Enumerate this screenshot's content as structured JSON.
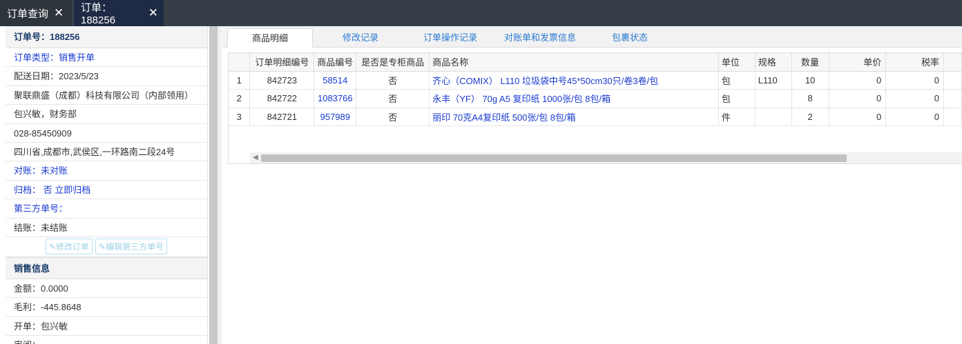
{
  "tabs": [
    {
      "label": "订单查询"
    },
    {
      "label": "订单：188256"
    }
  ],
  "close_glyph": "✕",
  "left": {
    "header": "订单号：188256",
    "rows": [
      {
        "text": "订单类型：销售开单",
        "link": true
      },
      {
        "text": "配送日期：2023/5/23",
        "link": false
      },
      {
        "text": "聚联鼎盛（成都）科技有限公司（内部领用）",
        "link": false
      },
      {
        "text": "包兴敏，财务部",
        "link": false
      },
      {
        "text": "028-85450909",
        "link": false
      },
      {
        "text": "四川省,成都市,武侯区,一环路南二段24号",
        "link": false
      },
      {
        "text": "对账：未对账",
        "link": true
      },
      {
        "text": "归档： 否 立即归档",
        "link": true
      },
      {
        "text": "第三方单号：",
        "link": true
      },
      {
        "text": "结账：未结账",
        "link": false
      }
    ],
    "buttons": {
      "edit_order": "修改订单",
      "edit_third": "编辑第三方单号"
    },
    "sales_section": "销售信息",
    "sales_rows": [
      {
        "text": "金额：0.0000"
      },
      {
        "text": "毛利：-445.8648"
      },
      {
        "text": "开单：包兴敏"
      },
      {
        "text": "审阅："
      }
    ]
  },
  "right_tabs": [
    {
      "label": "商品明细",
      "active": true
    },
    {
      "label": "修改记录",
      "active": false
    },
    {
      "label": "订单操作记录",
      "active": false
    },
    {
      "label": "对账单和发票信息",
      "active": false
    },
    {
      "label": "包裹状态",
      "active": false
    }
  ],
  "table": {
    "headers": [
      "",
      "订单明细编号",
      "商品编号",
      "是否是专柜商品",
      "商品名称",
      "单位",
      "规格",
      "数量",
      "单价",
      "税率"
    ],
    "rows": [
      [
        "1",
        "842723",
        "58514",
        "否",
        "齐心（COMIX） L110 垃圾袋中号45*50cm30只/卷3卷/包",
        "包",
        "L110",
        "10",
        "0",
        "0"
      ],
      [
        "2",
        "842722",
        "1083766",
        "否",
        "永丰（YF） 70g A5 复印纸 1000张/包 8包/箱",
        "包",
        "",
        "8",
        "0",
        "0"
      ],
      [
        "3",
        "842721",
        "957989",
        "否",
        "丽印 70克A4复印纸 500张/包 8包/箱",
        "件",
        "",
        "2",
        "0",
        "0"
      ]
    ]
  }
}
